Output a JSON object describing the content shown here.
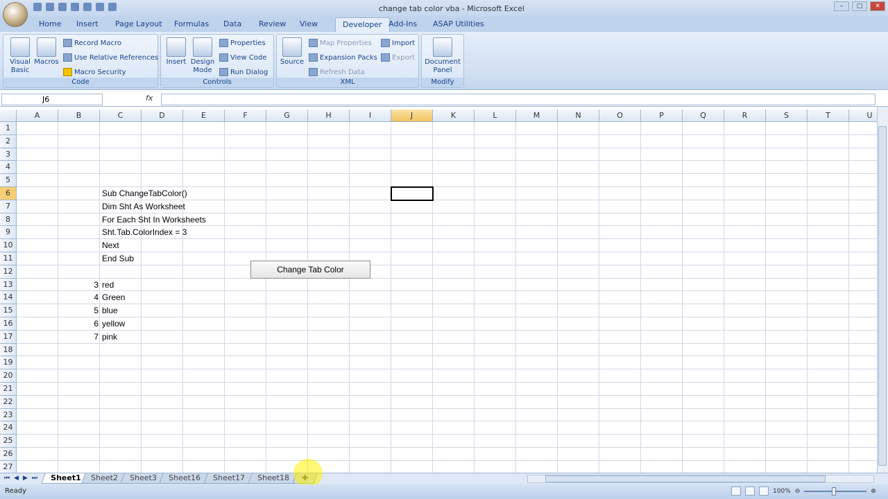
{
  "window": {
    "title": "change tab color vba - Microsoft Excel"
  },
  "ribbon": {
    "tabs": [
      "Home",
      "Insert",
      "Page Layout",
      "Formulas",
      "Data",
      "Review",
      "View",
      "Developer",
      "Add-Ins",
      "ASAP Utilities"
    ],
    "active_tab": "Developer",
    "groups": {
      "code": {
        "label": "Code",
        "visual_basic": "Visual Basic",
        "macros": "Macros",
        "record_macro": "Record Macro",
        "use_relative": "Use Relative References",
        "macro_security": "Macro Security"
      },
      "controls": {
        "label": "Controls",
        "insert": "Insert",
        "design_mode": "Design Mode",
        "properties": "Properties",
        "view_code": "View Code",
        "run_dialog": "Run Dialog"
      },
      "xml": {
        "label": "XML",
        "source": "Source",
        "map_properties": "Map Properties",
        "expansion_packs": "Expansion Packs",
        "refresh_data": "Refresh Data",
        "import": "Import",
        "export": "Export"
      },
      "modify": {
        "label": "Modify",
        "document_panel": "Document Panel"
      }
    }
  },
  "formula_bar": {
    "name_box": "J6",
    "fx": "fx",
    "value": ""
  },
  "grid": {
    "columns": [
      "A",
      "B",
      "C",
      "D",
      "E",
      "F",
      "G",
      "H",
      "I",
      "J",
      "K",
      "L",
      "M",
      "N",
      "O",
      "P",
      "Q",
      "R",
      "S",
      "T",
      "U"
    ],
    "rows": 27,
    "selected_cell": "J6",
    "cells": [
      {
        "ref": "C6",
        "value": "Sub ChangeTabColor()"
      },
      {
        "ref": "C7",
        "value": "Dim Sht As Worksheet"
      },
      {
        "ref": "C8",
        "value": "For Each Sht In Worksheets"
      },
      {
        "ref": "C9",
        "value": "Sht.Tab.ColorIndex = 3"
      },
      {
        "ref": "C10",
        "value": "Next"
      },
      {
        "ref": "C11",
        "value": "End Sub"
      },
      {
        "ref": "B13",
        "value": "3",
        "align": "right"
      },
      {
        "ref": "C13",
        "value": "red"
      },
      {
        "ref": "B14",
        "value": "4",
        "align": "right"
      },
      {
        "ref": "C14",
        "value": "Green"
      },
      {
        "ref": "B15",
        "value": "5",
        "align": "right"
      },
      {
        "ref": "C15",
        "value": "blue"
      },
      {
        "ref": "B16",
        "value": "6",
        "align": "right"
      },
      {
        "ref": "C16",
        "value": "yellow"
      },
      {
        "ref": "B17",
        "value": "7",
        "align": "right"
      },
      {
        "ref": "C17",
        "value": "pink"
      }
    ]
  },
  "macro_button": {
    "label": "Change Tab Color"
  },
  "sheets": {
    "tabs": [
      "Sheet1",
      "Sheet2",
      "Sheet3",
      "Sheet16",
      "Sheet17",
      "Sheet18"
    ],
    "active": "Sheet1"
  },
  "status": {
    "ready": "Ready",
    "zoom": "100%"
  }
}
